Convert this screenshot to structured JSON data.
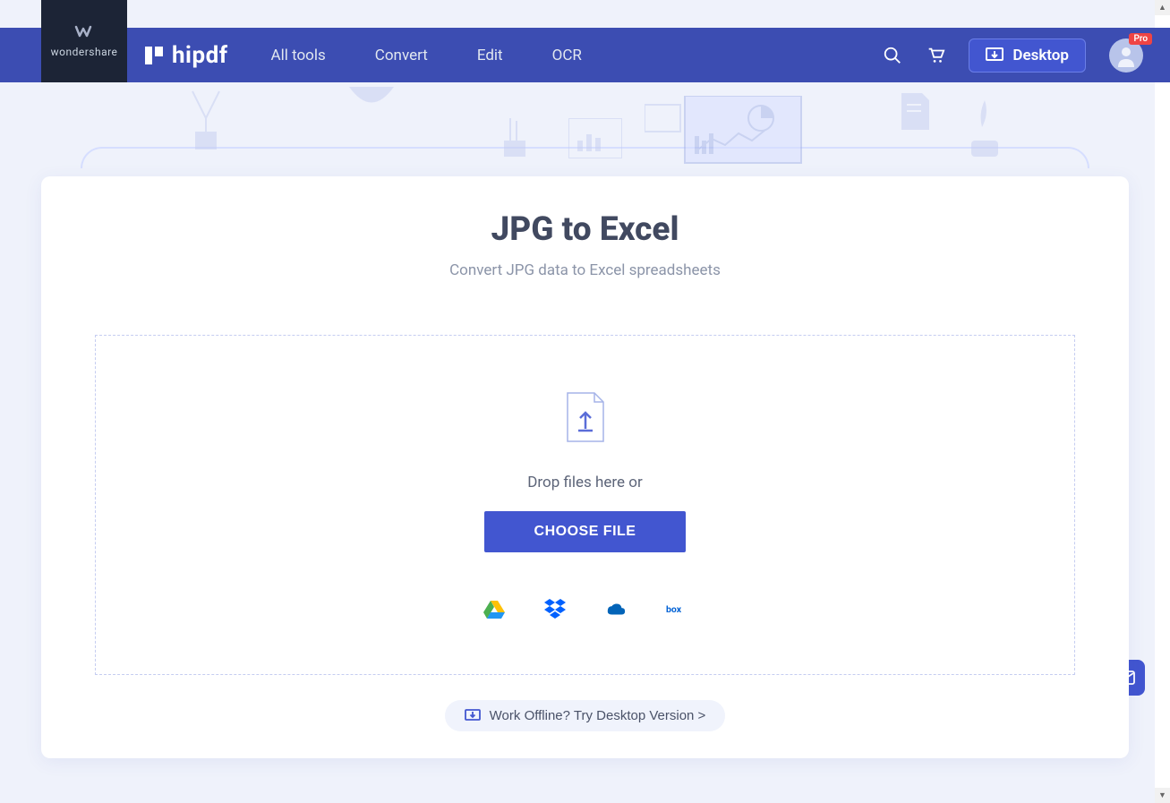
{
  "brand": {
    "parent": "wondershare",
    "product": "hipdf"
  },
  "nav": {
    "items": [
      "All tools",
      "Convert",
      "Edit",
      "OCR"
    ],
    "desktop": "Desktop",
    "pro": "Pro"
  },
  "page": {
    "title": "JPG to Excel",
    "subtitle": "Convert JPG data to Excel spreadsheets",
    "drop_text": "Drop files here or",
    "choose": "CHOOSE FILE",
    "offline": "Work Offline? Try Desktop Version >",
    "providers": [
      "google-drive",
      "dropbox",
      "onedrive",
      "box"
    ]
  }
}
